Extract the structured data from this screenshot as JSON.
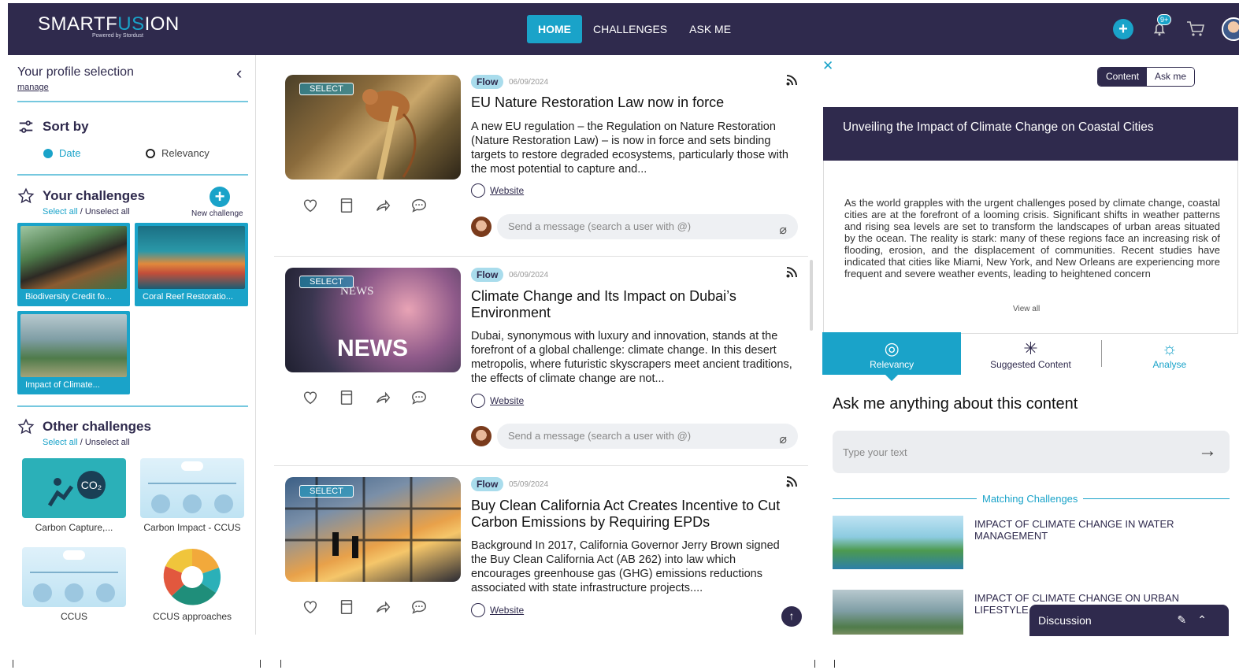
{
  "brand": {
    "name_a": "SMARTF",
    "name_b": "US",
    "name_c": "ION",
    "tagline": "Powered by Stordust",
    "accent": "#1aa3c9",
    "primary": "#2f2a4d"
  },
  "nav": [
    {
      "label": "HOME"
    },
    {
      "label": "CHALLENGES"
    },
    {
      "label": "ASK ME"
    }
  ],
  "header_icons": {
    "add": "plus-icon",
    "notification_badge": "9+",
    "cart": "cart-icon"
  },
  "sidebar": {
    "title": "Your profile selection",
    "manage": "manage",
    "sort": {
      "title": "Sort by",
      "options": [
        "Date",
        "Relevancy"
      ],
      "selected": "Date"
    },
    "your_challenges": {
      "title": "Your challenges",
      "select_all": "Select all",
      "separator": "/",
      "unselect_all": "Unselect all",
      "new_challenge": "New challenge",
      "tiles": [
        {
          "label": "Biodiversity Credit fo..."
        },
        {
          "label": "Coral Reef Restoratio..."
        },
        {
          "label": "Impact of Climate..."
        }
      ]
    },
    "other_challenges": {
      "title": "Other challenges",
      "select_all": "Select all",
      "separator": "/",
      "unselect_all": "Unselect all",
      "tiles": [
        {
          "label": "Carbon Capture,..."
        },
        {
          "label": "Carbon Impact - CCUS"
        },
        {
          "label": "CCUS"
        },
        {
          "label": "CCUS approaches"
        }
      ]
    }
  },
  "feed": {
    "select_label": "SELECT",
    "website_label": "Website",
    "message_placeholder": "Send a message (search a user with @)",
    "cards": [
      {
        "tag": "Flow",
        "date": "06/09/2024",
        "title": "EU Nature Restoration Law now in force",
        "desc": "A new EU regulation – the Regulation on Nature Restoration (Nature Restoration Law) – is now in force and sets binding targets to restore degraded ecosystems, particularly those with the most potential to capture and..."
      },
      {
        "tag": "Flow",
        "date": "06/09/2024",
        "title": "Climate Change and Its Impact on Dubai’s Environment",
        "desc": "Dubai, synonymous with luxury and innovation, stands at the forefront of a global challenge: climate change. In this desert metropolis, where futuristic skyscrapers meet ancient traditions, the effects of climate change are not...",
        "thumb_text_small": "NEWS",
        "thumb_text_big": "NEWS"
      },
      {
        "tag": "Flow",
        "date": "05/09/2024",
        "title": "Buy Clean California Act Creates Incentive to Cut Carbon Emissions by Requiring EPDs",
        "desc": "Background In 2017, California Governor Jerry Brown signed the Buy Clean California Act (AB 262) into law which encourages greenhouse gas (GHG) emissions reductions associated with state infrastructure projects...."
      }
    ]
  },
  "right_panel": {
    "toggle": {
      "content": "Content",
      "ask": "Ask me"
    },
    "article_title": "Unveiling the Impact of Climate Change on Coastal Cities",
    "article_text": "As the world grapples with the urgent challenges posed by climate change, coastal cities are at the forefront of a looming crisis. Significant shifts in weather patterns and rising sea levels are set to transform the landscapes of urban areas situated by the ocean. The reality is stark: many of these regions face an increasing risk of flooding, erosion, and the displacement of communities. Recent studies have indicated that cities like Miami, New York, and New Orleans are experiencing more frequent and severe weather events, leading to heightened concern",
    "view_all": "View all",
    "tabs": [
      {
        "label": "Relevancy"
      },
      {
        "label": "Suggested Content"
      },
      {
        "label": "Analyse"
      }
    ],
    "ask_title": "Ask me anything about this content",
    "ask_placeholder": "Type your text",
    "matching_label": "Matching Challenges",
    "matches": [
      {
        "title": "IMPACT OF CLIMATE CHANGE IN WATER MANAGEMENT"
      },
      {
        "title": "IMPACT OF CLIMATE CHANGE ON URBAN LIFESTYLE"
      }
    ]
  },
  "discussion": {
    "label": "Discussion"
  }
}
